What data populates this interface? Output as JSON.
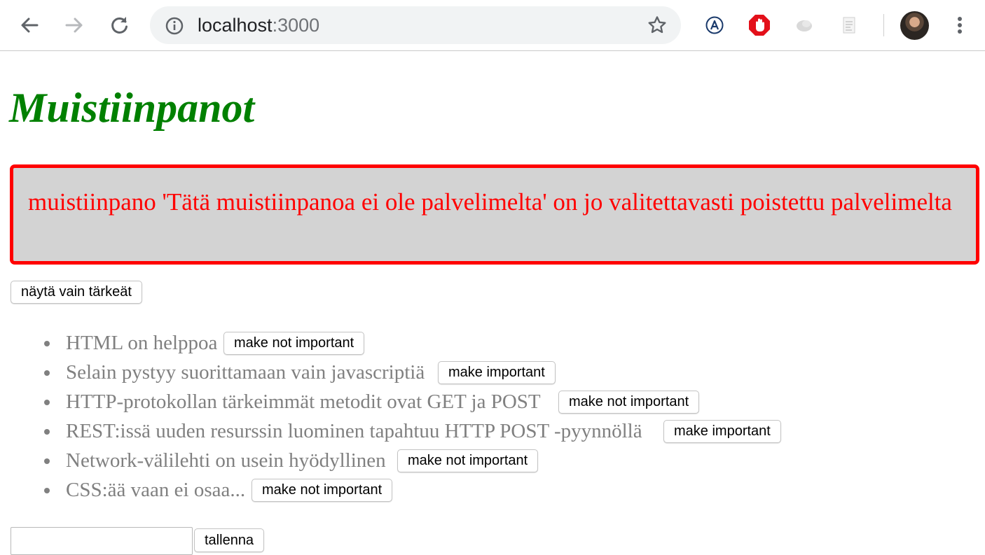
{
  "browser": {
    "url_host": "localhost",
    "url_port": ":3000",
    "icons": {
      "back": "back-arrow-icon",
      "forward": "forward-arrow-icon",
      "reload": "reload-icon",
      "info": "info-icon",
      "star": "bookmark-star-icon",
      "extensions": [
        "text-extension-icon",
        "adblock-stop-icon",
        "cloud-extension-icon",
        "page-extension-icon"
      ],
      "menu": "kebab-menu-icon"
    }
  },
  "page": {
    "title": "Muistiinpanot",
    "title_color": "#008000",
    "error_message": "muistiinpano 'Tätä muistiinpanoa ei ole palvelimelta' on jo valitettavasti poistettu palvelimelta",
    "error_color": "#ff0000",
    "error_background": "#d3d3d3",
    "toggle_button_label": "näytä vain tärkeät",
    "notes": [
      {
        "content": "HTML on helppoa",
        "button_label": "make not important"
      },
      {
        "content": "Selain pystyy suorittamaan vain javascriptiä",
        "button_label": "make important"
      },
      {
        "content": "HTTP-protokollan tärkeimmät metodit ovat GET ja POST",
        "button_label": "make not important"
      },
      {
        "content": "REST:issä uuden resurssin luominen tapahtuu HTTP POST -pyynnöllä",
        "button_label": "make important"
      },
      {
        "content": "Network-välilehti on usein hyödyllinen",
        "button_label": "make not important"
      },
      {
        "content": "CSS:ää vaan ei osaa...",
        "button_label": "make not important"
      }
    ],
    "new_note_value": "",
    "save_button_label": "tallenna"
  }
}
